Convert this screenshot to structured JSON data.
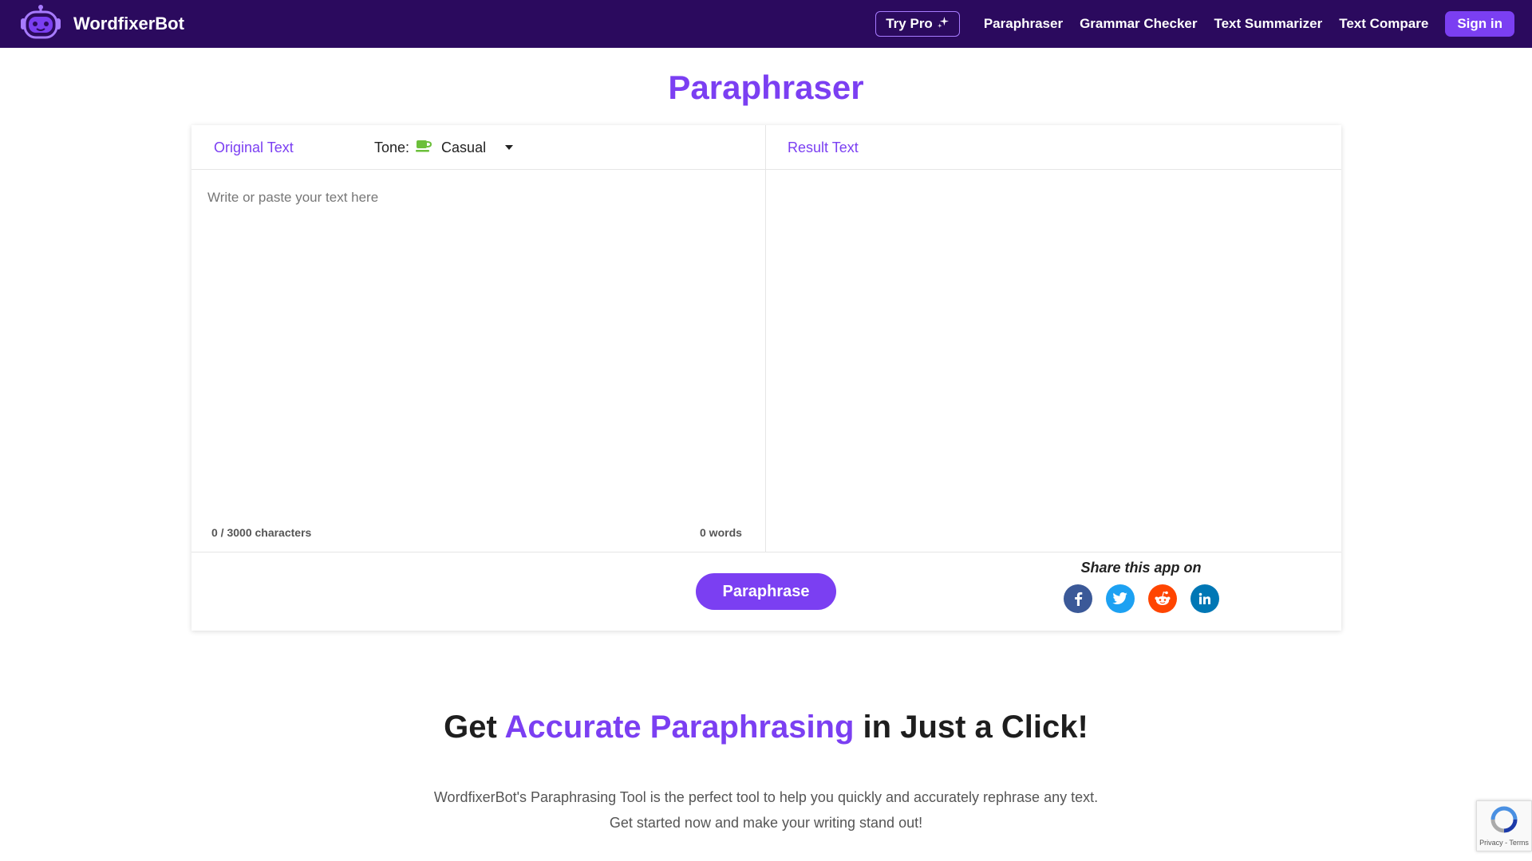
{
  "nav": {
    "brand": "WordfixerBot",
    "try_pro": "Try Pro",
    "links": [
      "Paraphraser",
      "Grammar Checker",
      "Text Summarizer",
      "Text Compare"
    ],
    "sign_in": "Sign in"
  },
  "page": {
    "title": "Paraphraser"
  },
  "editor": {
    "original_label": "Original Text",
    "tone_label": "Tone:",
    "tone_value": "Casual",
    "result_label": "Result Text",
    "placeholder": "Write or paste your text here",
    "char_count": "0 / 3000 characters",
    "word_count": "0 words",
    "paraphrase_button": "Paraphrase"
  },
  "share": {
    "title": "Share this app on",
    "icons": [
      "facebook-icon",
      "twitter-icon",
      "reddit-icon",
      "linkedin-icon"
    ]
  },
  "hero": {
    "prefix": "Get ",
    "accent": "Accurate Paraphrasing",
    "suffix": " in Just a Click!",
    "line1": "WordfixerBot's Paraphrasing Tool is the perfect tool to help you quickly and accurately rephrase any text.",
    "line2": "Get started now and make your writing stand out!"
  },
  "recaptcha": {
    "text": "Privacy - Terms"
  },
  "colors": {
    "nav_bg": "#2b0a5e",
    "accent": "#7b3ff2",
    "facebook": "#3b5998",
    "twitter": "#1da1f2",
    "reddit": "#ff4500",
    "linkedin": "#0077b5"
  }
}
